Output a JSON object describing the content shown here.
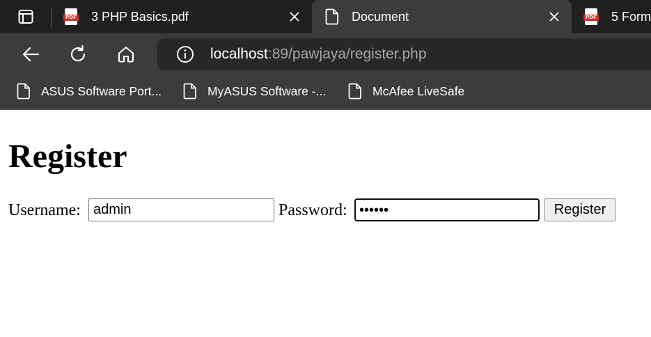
{
  "tabs": [
    {
      "title": "3 PHP Basics.pdf",
      "icon": "pdf-icon",
      "active": false
    },
    {
      "title": "Document",
      "icon": "document-icon",
      "active": true
    },
    {
      "title": "5 Form",
      "icon": "pdf-icon",
      "active": false
    }
  ],
  "pdf_badge": "PDF",
  "address": {
    "host": "localhost",
    "rest": ":89/pawjaya/register.php"
  },
  "bookmarks": [
    {
      "label": "ASUS Software Port..."
    },
    {
      "label": "MyASUS Software -..."
    },
    {
      "label": "McAfee LiveSafe"
    }
  ],
  "page": {
    "heading": "Register",
    "username_label": "Username:",
    "username_value": "admin",
    "password_label": "Password:",
    "password_value": "••••••",
    "submit_label": "Register"
  },
  "colors": {
    "tabstrip_bg": "#202020",
    "toolbar_bg": "#3c3c3c",
    "address_bg": "#272727",
    "pdf_red": "#d93025"
  }
}
